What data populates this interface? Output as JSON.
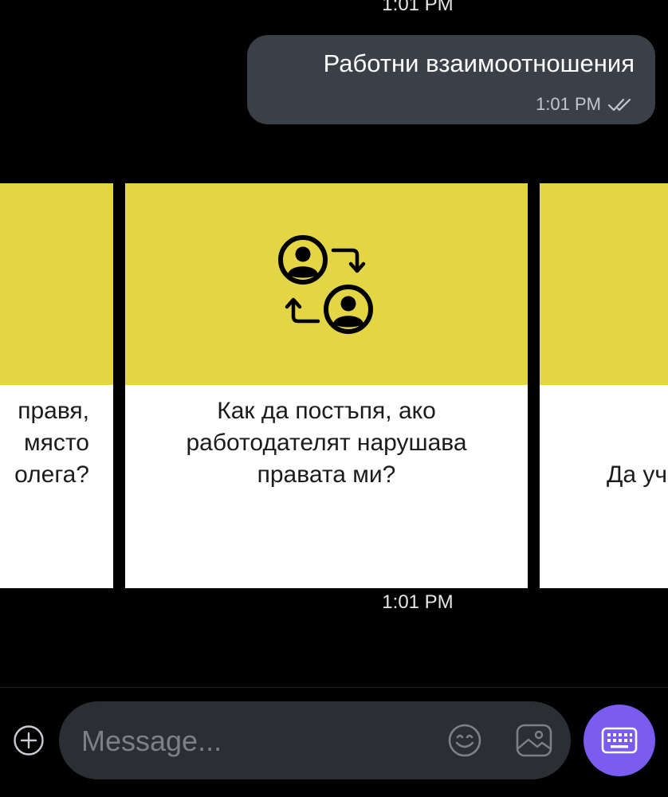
{
  "chat": {
    "top_timestamp": "1:01 PM",
    "outgoing": {
      "text": "Работни взаимоотношения",
      "time": "1:01 PM",
      "status_icon": "double-check-icon"
    },
    "carousel_timestamp": "1:01 PM",
    "cards": [
      {
        "lines": [
          "правя,",
          "място",
          "олега?"
        ]
      },
      {
        "icon": "people-swap-icon",
        "lines": [
          "Как да постъпя, ако",
          "работодателят нарушава",
          "правата ми?"
        ]
      },
      {
        "lines": [
          "Да уч"
        ]
      }
    ]
  },
  "composer": {
    "placeholder": "Message...",
    "add_icon": "plus-circle-icon",
    "emoji_icon": "smiley-icon",
    "gallery_icon": "image-icon",
    "keyboard_icon": "keyboard-icon"
  },
  "colors": {
    "background": "#000000",
    "bubble": "#3b3f47",
    "card_header": "#e3d544",
    "card_body": "#ffffff",
    "accent": "#7b5cf0",
    "input_bar": "#2b2e33"
  }
}
